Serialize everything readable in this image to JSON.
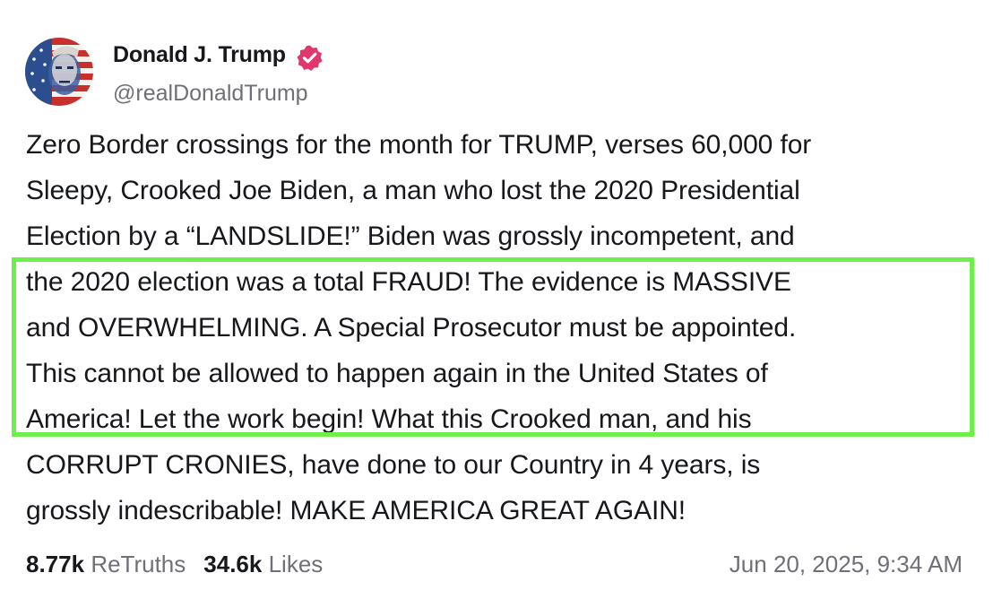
{
  "author": {
    "name": "Donald J. Trump",
    "handle": "@realDonaldTrump",
    "verified_color": "#e0386d",
    "avatar_icon": "avatar-flag-portrait"
  },
  "post": {
    "lines": [
      "Zero Border crossings for the month for TRUMP, verses 60,000 for",
      "Sleepy, Crooked Joe Biden, a man who lost the 2020 Presidential",
      "Election by a “LANDSLIDE!” Biden was grossly incompetent, and",
      "the 2020 election was a total FRAUD! The evidence is MASSIVE",
      "and OVERWHELMING. A Special Prosecutor must be appointed.",
      "This cannot be allowed to happen again in the United States of",
      "America! Let the work begin! What this Crooked man, and his",
      "CORRUPT CRONIES, have done to our Country in 4 years, is",
      "grossly indescribable! MAKE AMERICA GREAT AGAIN!"
    ],
    "highlight_color": "#6fef4a"
  },
  "stats": {
    "retruths_count": "8.77k",
    "retruths_label": "ReTruths",
    "likes_count": "34.6k",
    "likes_label": "Likes"
  },
  "timestamp": "Jun 20, 2025, 9:34 AM"
}
